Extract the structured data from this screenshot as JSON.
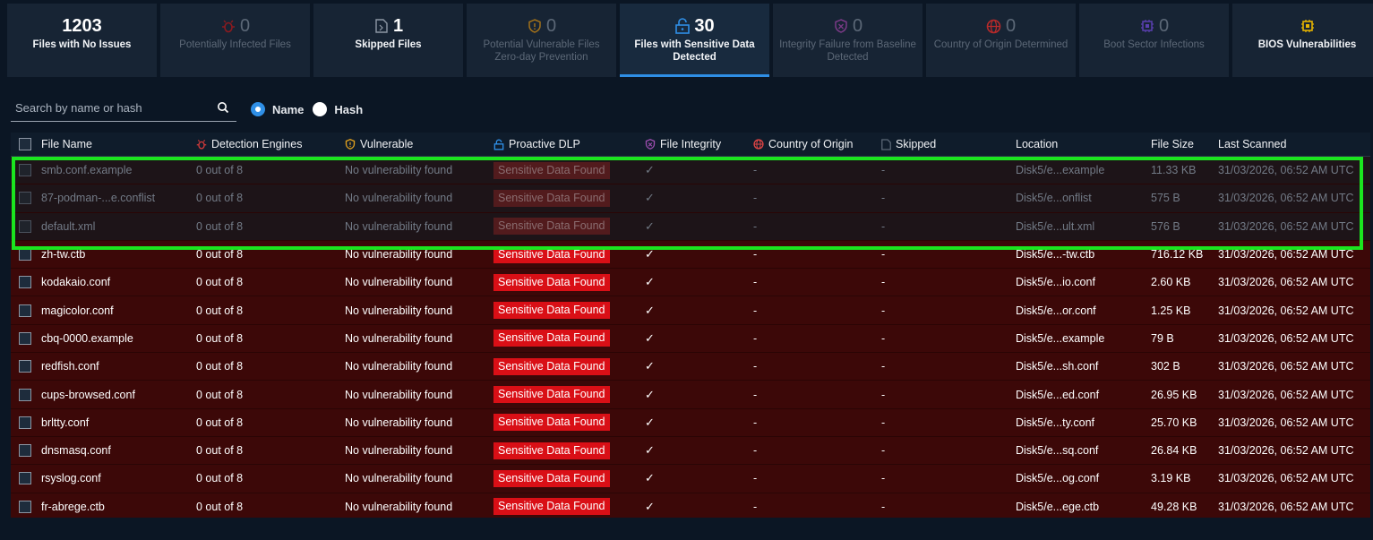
{
  "cards": [
    {
      "num": "1203",
      "label": "Files with No Issues",
      "icon": "",
      "state": "normal"
    },
    {
      "num": "0",
      "label": "Potentially Infected Files",
      "icon": "bug-icon",
      "state": "dim"
    },
    {
      "num": "1",
      "label": "Skipped Files",
      "icon": "skipped-file-icon",
      "state": "normal"
    },
    {
      "num": "0",
      "label": "Potential Vulnerable Files Zero-day Prevention",
      "icon": "warning-shield-icon",
      "state": "dim"
    },
    {
      "num": "30",
      "label": "Files with Sensitive Data Detected",
      "icon": "lock-icon",
      "state": "active"
    },
    {
      "num": "0",
      "label": "Integrity Failure from Baseline Detected",
      "icon": "integrity-shield-icon",
      "state": "dim"
    },
    {
      "num": "0",
      "label": "Country of Origin Determined",
      "icon": "globe-icon",
      "state": "dim"
    },
    {
      "num": "0",
      "label": "Boot Sector Infections",
      "icon": "chip-icon",
      "state": "dim"
    },
    {
      "num": "",
      "label": "BIOS Vulnerabilities",
      "icon": "bios-chip-icon",
      "state": "normal"
    }
  ],
  "search": {
    "placeholder": "Search by name or hash",
    "options": [
      "Name",
      "Hash"
    ],
    "selected": "Name"
  },
  "columns": [
    "File Name",
    "Detection Engines",
    "Vulnerable",
    "Proactive DLP",
    "File Integrity",
    "Country of Origin",
    "Skipped",
    "Location",
    "File Size",
    "Last Scanned"
  ],
  "colors": {
    "accent": "#2f8fe6",
    "danger": "#d90f16",
    "highlight": "#1be51f"
  },
  "rows": [
    {
      "name": "smb.conf.example",
      "engines": "0 out of 8",
      "vuln": "No vulnerability found",
      "dlp": "Sensitive Data Found",
      "integrity": "✓",
      "country": "-",
      "skipped": "-",
      "location": "Disk5/e...example",
      "size": "11.33 KB",
      "scanned": "31/03/2026, 06:52 AM UTC",
      "dim": true
    },
    {
      "name": "87-podman-...e.conflist",
      "engines": "0 out of 8",
      "vuln": "No vulnerability found",
      "dlp": "Sensitive Data Found",
      "integrity": "✓",
      "country": "-",
      "skipped": "-",
      "location": "Disk5/e...onflist",
      "size": "575 B",
      "scanned": "31/03/2026, 06:52 AM UTC",
      "dim": true
    },
    {
      "name": "default.xml",
      "engines": "0 out of 8",
      "vuln": "No vulnerability found",
      "dlp": "Sensitive Data Found",
      "integrity": "✓",
      "country": "-",
      "skipped": "-",
      "location": "Disk5/e...ult.xml",
      "size": "576 B",
      "scanned": "31/03/2026, 06:52 AM UTC",
      "dim": true
    },
    {
      "name": "zh-tw.ctb",
      "engines": "0 out of 8",
      "vuln": "No vulnerability found",
      "dlp": "Sensitive Data Found",
      "integrity": "✓",
      "country": "-",
      "skipped": "-",
      "location": "Disk5/e...-tw.ctb",
      "size": "716.12 KB",
      "scanned": "31/03/2026, 06:52 AM UTC",
      "dim": false
    },
    {
      "name": "kodakaio.conf",
      "engines": "0 out of 8",
      "vuln": "No vulnerability found",
      "dlp": "Sensitive Data Found",
      "integrity": "✓",
      "country": "-",
      "skipped": "-",
      "location": "Disk5/e...io.conf",
      "size": "2.60 KB",
      "scanned": "31/03/2026, 06:52 AM UTC",
      "dim": false
    },
    {
      "name": "magicolor.conf",
      "engines": "0 out of 8",
      "vuln": "No vulnerability found",
      "dlp": "Sensitive Data Found",
      "integrity": "✓",
      "country": "-",
      "skipped": "-",
      "location": "Disk5/e...or.conf",
      "size": "1.25 KB",
      "scanned": "31/03/2026, 06:52 AM UTC",
      "dim": false
    },
    {
      "name": "cbq-0000.example",
      "engines": "0 out of 8",
      "vuln": "No vulnerability found",
      "dlp": "Sensitive Data Found",
      "integrity": "✓",
      "country": "-",
      "skipped": "-",
      "location": "Disk5/e...example",
      "size": "79 B",
      "scanned": "31/03/2026, 06:52 AM UTC",
      "dim": false
    },
    {
      "name": "redfish.conf",
      "engines": "0 out of 8",
      "vuln": "No vulnerability found",
      "dlp": "Sensitive Data Found",
      "integrity": "✓",
      "country": "-",
      "skipped": "-",
      "location": "Disk5/e...sh.conf",
      "size": "302 B",
      "scanned": "31/03/2026, 06:52 AM UTC",
      "dim": false
    },
    {
      "name": "cups-browsed.conf",
      "engines": "0 out of 8",
      "vuln": "No vulnerability found",
      "dlp": "Sensitive Data Found",
      "integrity": "✓",
      "country": "-",
      "skipped": "-",
      "location": "Disk5/e...ed.conf",
      "size": "26.95 KB",
      "scanned": "31/03/2026, 06:52 AM UTC",
      "dim": false
    },
    {
      "name": "brltty.conf",
      "engines": "0 out of 8",
      "vuln": "No vulnerability found",
      "dlp": "Sensitive Data Found",
      "integrity": "✓",
      "country": "-",
      "skipped": "-",
      "location": "Disk5/e...ty.conf",
      "size": "25.70 KB",
      "scanned": "31/03/2026, 06:52 AM UTC",
      "dim": false
    },
    {
      "name": "dnsmasq.conf",
      "engines": "0 out of 8",
      "vuln": "No vulnerability found",
      "dlp": "Sensitive Data Found",
      "integrity": "✓",
      "country": "-",
      "skipped": "-",
      "location": "Disk5/e...sq.conf",
      "size": "26.84 KB",
      "scanned": "31/03/2026, 06:52 AM UTC",
      "dim": false
    },
    {
      "name": "rsyslog.conf",
      "engines": "0 out of 8",
      "vuln": "No vulnerability found",
      "dlp": "Sensitive Data Found",
      "integrity": "✓",
      "country": "-",
      "skipped": "-",
      "location": "Disk5/e...og.conf",
      "size": "3.19 KB",
      "scanned": "31/03/2026, 06:52 AM UTC",
      "dim": false
    },
    {
      "name": "fr-abrege.ctb",
      "engines": "0 out of 8",
      "vuln": "No vulnerability found",
      "dlp": "Sensitive Data Found",
      "integrity": "✓",
      "country": "-",
      "skipped": "-",
      "location": "Disk5/e...ege.ctb",
      "size": "49.28 KB",
      "scanned": "31/03/2026, 06:52 AM UTC",
      "dim": false
    }
  ]
}
